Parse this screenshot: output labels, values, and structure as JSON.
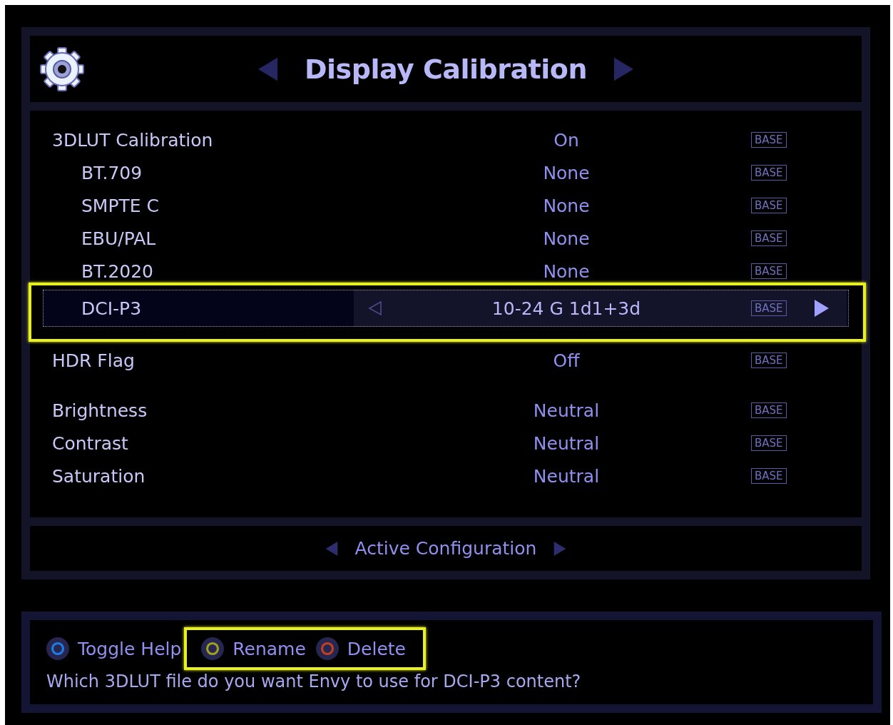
{
  "header": {
    "title": "Display Calibration"
  },
  "groups": [
    {
      "rows": [
        {
          "label": "3DLUT Calibration",
          "value": "On",
          "badge": "BASE",
          "selected": false,
          "highlighted": false,
          "children": [
            {
              "label": "BT.709",
              "value": "None",
              "badge": "BASE",
              "selected": false,
              "highlighted": false
            },
            {
              "label": "SMPTE C",
              "value": "None",
              "badge": "BASE",
              "selected": false,
              "highlighted": false
            },
            {
              "label": "EBU/PAL",
              "value": "None",
              "badge": "BASE",
              "selected": false,
              "highlighted": false
            },
            {
              "label": "BT.2020",
              "value": "None",
              "badge": "BASE",
              "selected": false,
              "highlighted": false
            },
            {
              "label": "DCI-P3",
              "value": "10-24 G 1d1+3d",
              "badge": "BASE",
              "selected": true,
              "highlighted": true
            }
          ]
        }
      ]
    },
    {
      "rows": [
        {
          "label": "HDR Flag",
          "value": "Off",
          "badge": "BASE",
          "selected": false,
          "highlighted": false
        }
      ]
    },
    {
      "rows": [
        {
          "label": "Brightness",
          "value": "Neutral",
          "badge": "BASE",
          "selected": false,
          "highlighted": false
        },
        {
          "label": "Contrast",
          "value": "Neutral",
          "badge": "BASE",
          "selected": false,
          "highlighted": false
        },
        {
          "label": "Saturation",
          "value": "Neutral",
          "badge": "BASE",
          "selected": false,
          "highlighted": false
        }
      ]
    }
  ],
  "footer": {
    "label": "Active Configuration"
  },
  "help": {
    "actions": [
      {
        "label": "Toggle Help",
        "color": "#1e7be0",
        "highlighted": false
      },
      {
        "label": "Rename",
        "color": "#a0a020",
        "highlighted": true
      },
      {
        "label": "Delete",
        "color": "#c04020",
        "highlighted": true
      }
    ],
    "text": "Which 3DLUT file do you want Envy to use for DCI-P3 content?"
  }
}
